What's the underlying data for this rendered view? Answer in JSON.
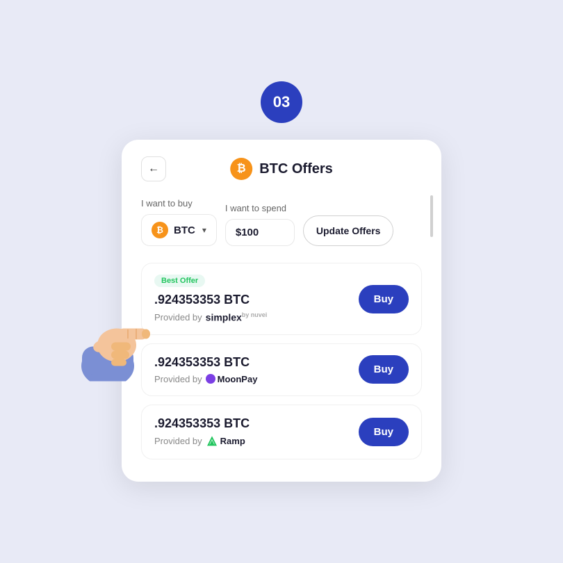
{
  "step": {
    "number": "03"
  },
  "header": {
    "back_label": "←",
    "title": "BTC Offers",
    "btc_symbol": "₿"
  },
  "controls": {
    "buy_label": "I want to buy",
    "spend_label": "I want to spend",
    "crypto": "BTC",
    "amount": "$100",
    "update_btn": "Update Offers"
  },
  "offers": [
    {
      "best": true,
      "best_label": "Best Offer",
      "amount": ".924353353 BTC",
      "provider_prefix": "Provided by",
      "provider": "simplex",
      "buy_label": "Buy"
    },
    {
      "best": false,
      "amount": ".924353353 BTC",
      "provider_prefix": "Provided by",
      "provider": "moonpay",
      "buy_label": "Buy"
    },
    {
      "best": false,
      "amount": ".924353353 BTC",
      "provider_prefix": "Provided by",
      "provider": "ramp",
      "buy_label": "Buy"
    }
  ]
}
